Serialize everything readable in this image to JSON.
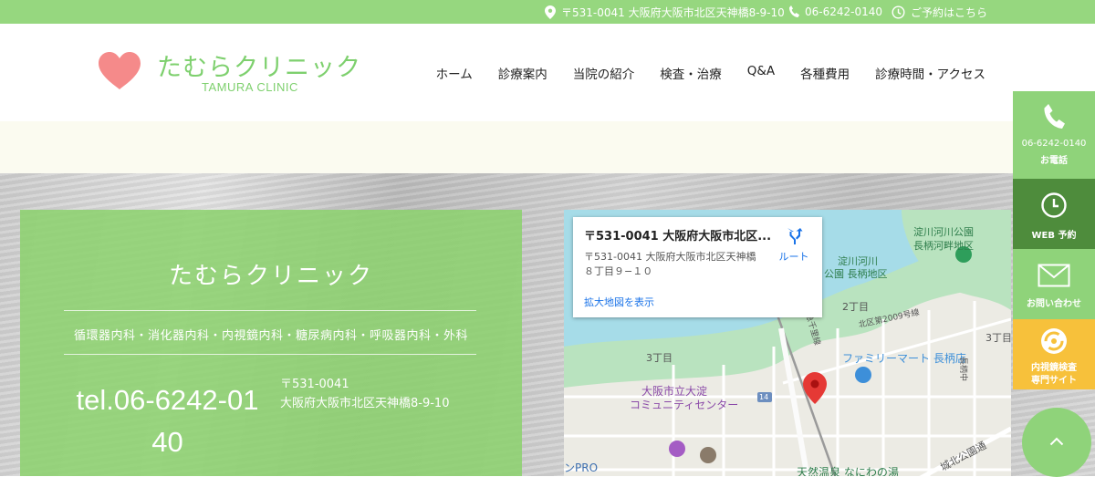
{
  "topbar": {
    "address": "〒531-0041 大阪府大阪市北区天神橋8-9-10",
    "phone": "06-6242-0140",
    "reservation": "ご予約はこちら"
  },
  "header": {
    "logo_jp": "たむらクリニック",
    "logo_en": "TAMURA CLINIC",
    "nav": [
      "ホーム",
      "診療案内",
      "当院の紹介",
      "検査・治療",
      "Q&A",
      "各種費用",
      "診療時間・アクセス"
    ]
  },
  "info": {
    "clinic_name": "たむらクリニック",
    "departments": "循環器内科・消化器内科・内視鏡内科・糖尿病内科・呼吸器内科・外科",
    "tel": "tel.06-6242-0140",
    "postal": "〒531-0041",
    "address": "大阪府大阪市北区天神橋8-9-10"
  },
  "map": {
    "popup_title": "〒531-0041 大阪府大阪市北区...",
    "popup_address": "〒531-0041 大阪府大阪市北区天神橋８丁目９−１０",
    "popup_link": "拡大地図を表示",
    "route_label": "ルート",
    "labels": {
      "park1": "淀川河川公園",
      "park1b": "長柄河畔地区",
      "park2": "淀川河川",
      "park2b": "公園 長柄地区",
      "chome2": "2丁目",
      "chome3a": "3丁目",
      "chome3b": "3丁目",
      "route2009": "北区第2009号線",
      "family_mart": "ファミリーマート 長柄店",
      "community": "大阪市立大淀",
      "community2": "コミュニティセンター",
      "road14": "14",
      "onsen": "天然温泉 なにわの湯",
      "park_street": "城北公園通",
      "nagara_naka": "長柄中",
      "pro": "ンPRO",
      "keihan": "阪急千里線"
    }
  },
  "sidebar": {
    "phone_number": "06-6242-0140",
    "phone_label": "お電話",
    "web_label": "WEB 予約",
    "contact_label": "お問い合わせ",
    "endoscopy_line1": "内視鏡検査",
    "endoscopy_line2": "専門サイト"
  },
  "colors": {
    "brand_green": "#96d77f",
    "logo_heart": "#f58a8a",
    "dark_green": "#4e8c3c",
    "yellow": "#f7c13b"
  }
}
